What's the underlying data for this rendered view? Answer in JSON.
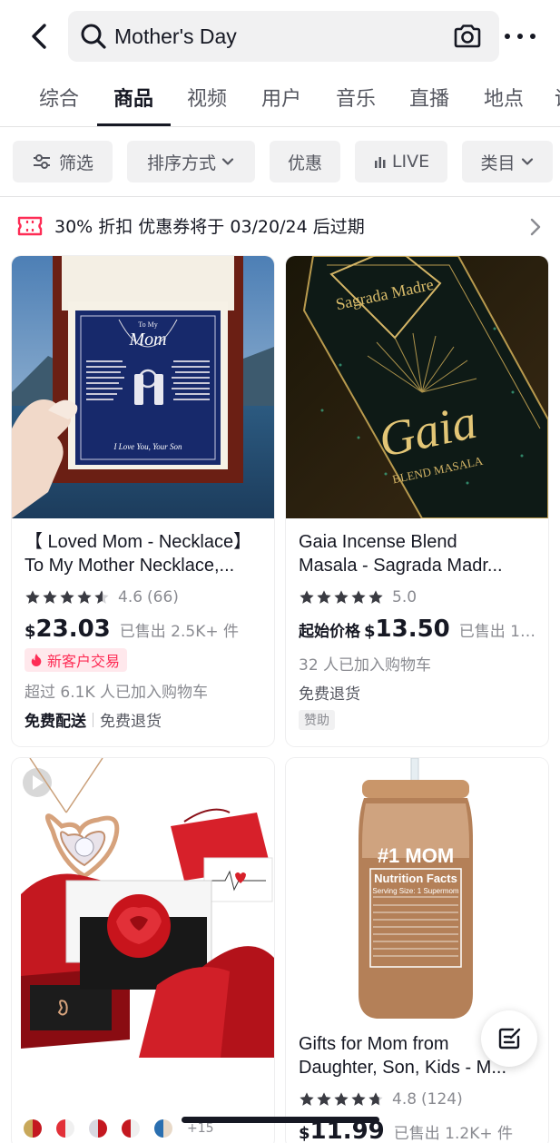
{
  "header": {
    "search_query": "Mother's Day"
  },
  "tabs": [
    {
      "label": "综合"
    },
    {
      "label": "商品",
      "active": true
    },
    {
      "label": "视频"
    },
    {
      "label": "用户"
    },
    {
      "label": "音乐"
    },
    {
      "label": "直播"
    },
    {
      "label": "地点"
    },
    {
      "label": "话"
    }
  ],
  "filters": {
    "filter_label": "筛选",
    "sort_label": "排序方式",
    "deals_label": "优惠",
    "live_label": "LIVE",
    "category_label": "类目"
  },
  "coupon": {
    "text": "30% 折扣 优惠券将于 03/20/24 后过期"
  },
  "products": [
    {
      "title_line1": "【 Loved Mom - Necklace】",
      "title_line2": "To My Mother Necklace,...",
      "rating": "4.6",
      "rating_count": "(66)",
      "stars": 4.6,
      "currency": "$",
      "price": "23.03",
      "sold": "已售出 2.5K+ 件",
      "badge": "新客户交易",
      "cart_text": "超过 6.1K 人已加入购物车",
      "shipping": "免费配送",
      "returns": "免费退货"
    },
    {
      "title_line1": "Gaia Incense Blend",
      "title_line2": "Masala - Sagrada Madr...",
      "rating": "5.0",
      "rating_count": "",
      "stars": 5.0,
      "price_prefix": "起始价格",
      "currency": "$",
      "price": "13.50",
      "sold": "已售出 18...",
      "cart_text": "32 人已加入购物车",
      "returns": "免费退货",
      "sponsored": "赞助"
    },
    {
      "swatches_more": "+15"
    },
    {
      "title_line1": "Gifts for Mom from",
      "title_line2": "Daughter, Son, Kids - M...",
      "rating": "4.8",
      "rating_count": "(124)",
      "stars": 4.8,
      "currency": "$",
      "price": "11.99",
      "sold": "已售出 1.2K+ 件"
    }
  ],
  "images": {
    "product1_box_heading": "To My",
    "product1_box_name": "Mom",
    "product1_box_sign": "I Love You, Your Son",
    "product2_brand": "Sagrada Madre",
    "product2_name": "Gaia",
    "product2_sub": "BLEND MASALA",
    "product4_heading": "#1 MOM",
    "product4_facts": "Nutrition Facts",
    "product4_serving": "Serving Size: 1 Supermom"
  },
  "colors": {
    "accent": "#fe2c55",
    "text": "#161823",
    "muted": "#8a8b91",
    "chip_bg": "#f1f1f2"
  }
}
